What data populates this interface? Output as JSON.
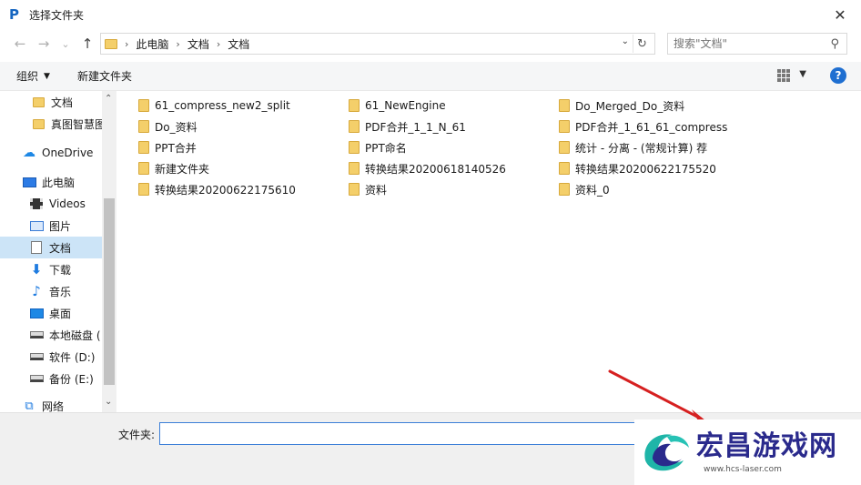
{
  "window": {
    "title": "选择文件夹",
    "app_icon_glyph": "P",
    "close_glyph": "✕"
  },
  "address": {
    "back_glyph": "←",
    "forward_glyph": "→",
    "recent_glyph": "⌄",
    "up_glyph": "↑",
    "crumbs": [
      "此电脑",
      "文档",
      "文档"
    ],
    "separator_glyph": "›",
    "dropdown_glyph": "⌄",
    "refresh_glyph": "↻",
    "search_placeholder": "搜索\"文档\"",
    "search_glyph": "⚲"
  },
  "toolbar": {
    "organize_label": "组织",
    "caret_glyph": "▼",
    "new_folder_label": "新建文件夹",
    "view_caret_glyph": "▼",
    "help_glyph": "?"
  },
  "nav": {
    "items": [
      {
        "label": "文档",
        "icon": "folder-icon"
      },
      {
        "label": "真图智慧图",
        "icon": "folder-icon"
      },
      {
        "label": "OneDrive",
        "icon": "cloud-icon",
        "glyph": "☁"
      },
      {
        "label": "此电脑",
        "icon": "computer-icon"
      },
      {
        "label": "Videos",
        "icon": "video-icon"
      },
      {
        "label": "图片",
        "icon": "picture-icon"
      },
      {
        "label": "文档",
        "icon": "document-icon",
        "selected": true
      },
      {
        "label": "下载",
        "icon": "download-icon",
        "glyph": "⬇"
      },
      {
        "label": "音乐",
        "icon": "music-icon",
        "glyph": "♪"
      },
      {
        "label": "桌面",
        "icon": "desktop-icon"
      },
      {
        "label": "本地磁盘 (",
        "icon": "disk-icon"
      },
      {
        "label": "软件 (D:)",
        "icon": "disk-icon"
      },
      {
        "label": "备份 (E:)",
        "icon": "disk-icon"
      },
      {
        "label": "网络",
        "icon": "network-icon",
        "glyph": "⧉"
      }
    ],
    "scroll_up_glyph": "⌃",
    "scroll_down_glyph": "⌄"
  },
  "files": {
    "col1": [
      "61_compress_new2_split",
      "Do_资料",
      "PPT合并",
      "新建文件夹",
      "转换结果20200622175610"
    ],
    "col2": [
      "61_NewEngine",
      "PDF合并_1_1_N_61",
      "PPT命名",
      "转换结果20200618140526",
      "资料"
    ],
    "col3": [
      "Do_Merged_Do_资料",
      "PDF合并_1_61_61_compress",
      "统计 - 分离 - (常规计算) 荐",
      "转换结果20200622175520",
      "资料_0"
    ]
  },
  "bottom": {
    "folder_label": "文件夹:",
    "folder_value": ""
  },
  "annotation": {
    "arrow_color": "#d62020"
  },
  "watermark": {
    "name": "宏昌游戏网",
    "url": "www.hcs-laser.com"
  }
}
